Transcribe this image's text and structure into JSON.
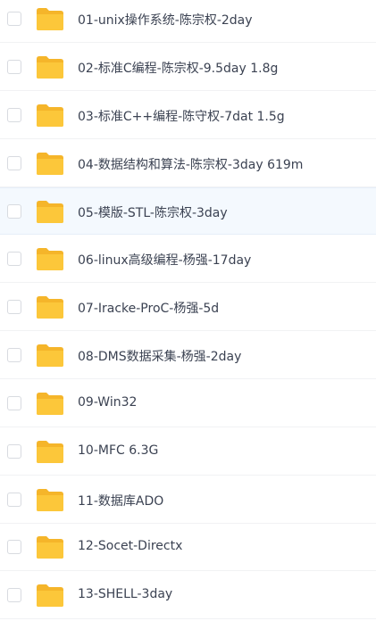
{
  "files": [
    {
      "name": "01-unix操作系统-陈宗权-2day"
    },
    {
      "name": "02-标准C编程-陈宗权-9.5day 1.8g"
    },
    {
      "name": "03-标准C++编程-陈守权-7dat 1.5g"
    },
    {
      "name": "04-数据结构和算法-陈宗权-3day 619m"
    },
    {
      "name": "05-模版-STL-陈宗权-3day",
      "hovered": true
    },
    {
      "name": "06-linux高级编程-杨强-17day"
    },
    {
      "name": "07-Iracke-ProC-杨强-5d"
    },
    {
      "name": "08-DMS数据采集-杨强-2day"
    },
    {
      "name": "09-Win32"
    },
    {
      "name": "10-MFC 6.3G"
    },
    {
      "name": "11-数据库ADO"
    },
    {
      "name": "12-Socet-Directx"
    },
    {
      "name": "13-SHELL-3day"
    }
  ],
  "icon": "folder-icon",
  "colors": {
    "folder": "#fcc73a",
    "folder_tab": "#f5b52a",
    "hover_row": "#f4f9fe",
    "text": "#3b4252"
  }
}
